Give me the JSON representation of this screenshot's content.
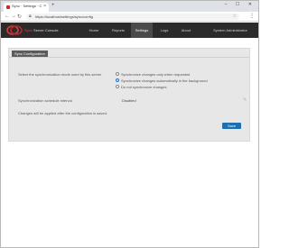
{
  "browser": {
    "tab_title": "Sync · Settings · Configuration",
    "new_tab_symbol": "+",
    "url": "https://localhost/settings/sync/config",
    "window_controls": "– ☐ ✕"
  },
  "app": {
    "brand_prefix": "Sync",
    "brand_suffix": "Server Console",
    "nav": [
      {
        "label": "Home"
      },
      {
        "label": "Reports"
      },
      {
        "label": "Settings",
        "active": true
      },
      {
        "label": "Logs"
      },
      {
        "label": "About"
      },
      {
        "label": "System Administrator"
      }
    ]
  },
  "panel": {
    "title": "Sync Configuration",
    "sync_mode_label": "Select the synchronization mode used by this server",
    "options": [
      {
        "label": "Synchronize changes only when requested",
        "checked": false
      },
      {
        "label": "Synchronize changes automatically in the background",
        "checked": true
      },
      {
        "label": "Do not synchronize changes",
        "checked": false
      }
    ],
    "schedule_label": "Synchronization schedule interval",
    "schedule_value": "Disabled",
    "note": "Changes will be applied after the configuration is saved.",
    "save_label": "Save"
  },
  "colors": {
    "accent": "#1f6fae",
    "brand_red": "#e04040",
    "navbar_bg": "#2b2b2b"
  }
}
